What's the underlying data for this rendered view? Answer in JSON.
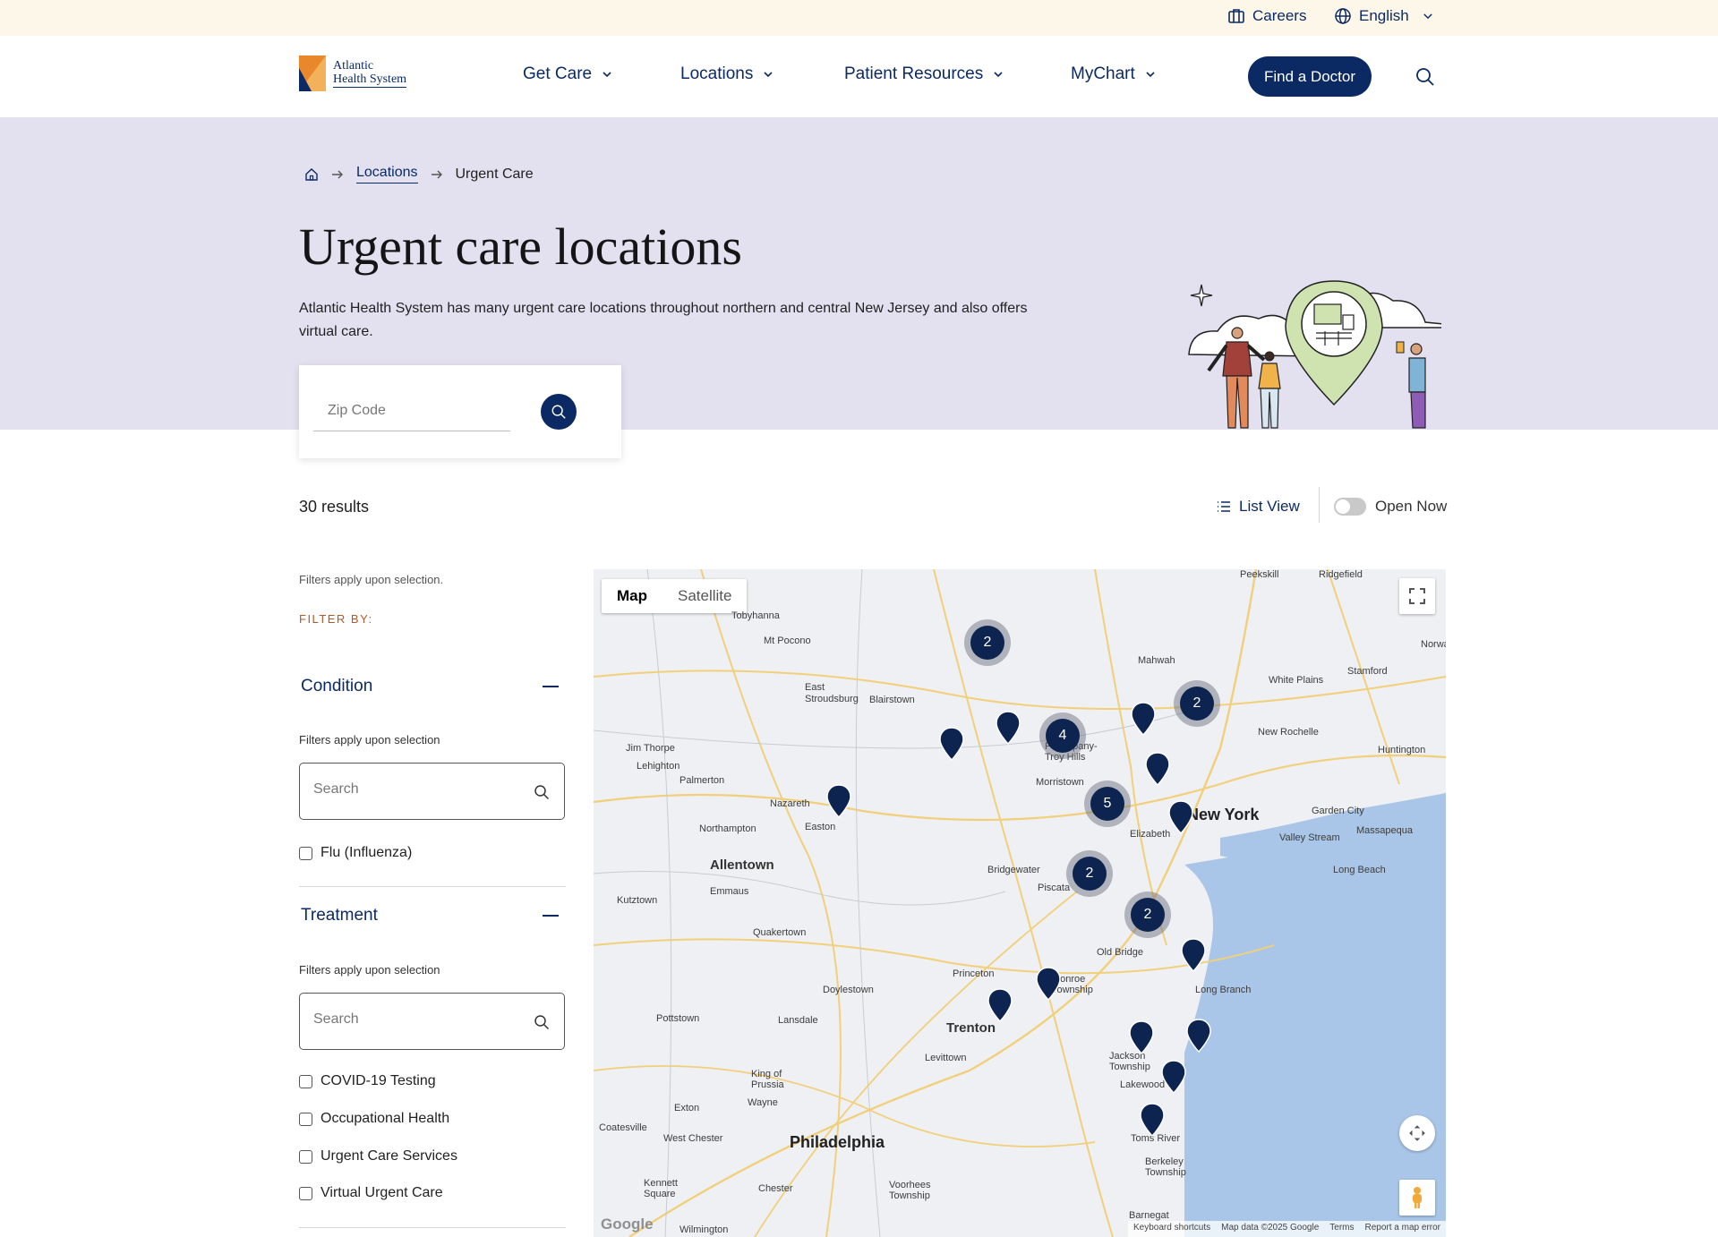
{
  "utility": {
    "careers": "Careers",
    "language": "English"
  },
  "brand": {
    "line1": "Atlantic",
    "line2": "Health System",
    "navy": "#0b2a63",
    "orange": "#e8872b"
  },
  "nav": [
    {
      "label": "Get Care"
    },
    {
      "label": "Locations"
    },
    {
      "label": "Patient Resources"
    },
    {
      "label": "MyChart"
    }
  ],
  "cta": {
    "find_doctor": "Find a Doctor"
  },
  "breadcrumb": {
    "link": "Locations",
    "current": "Urgent Care"
  },
  "hero": {
    "title": "Urgent care locations",
    "description": "Atlantic Health System has many urgent care locations throughout northern and central New Jersey and also offers virtual care.",
    "background": "#e3e0ef"
  },
  "zip": {
    "placeholder": "Zip Code"
  },
  "results": {
    "count": "30 results",
    "list_view": "List View",
    "open_now": "Open Now"
  },
  "filters": {
    "note": "Filters apply upon selection.",
    "filter_by": "FILTER BY:",
    "condition": {
      "title": "Condition",
      "note": "Filters apply upon selection",
      "search_placeholder": "Search",
      "options": [
        "Flu (Influenza)"
      ]
    },
    "treatment": {
      "title": "Treatment",
      "note": "Filters apply upon selection",
      "search_placeholder": "Search",
      "options": [
        "COVID-19 Testing",
        "Occupational Health",
        "Urgent Care Services",
        "Virtual Urgent Care"
      ]
    }
  },
  "map": {
    "tabs": {
      "map": "Map",
      "satellite": "Satellite"
    },
    "places": {
      "new_york": "New York",
      "philadelphia": "Philadelphia",
      "trenton": "Trenton",
      "allentown": "Allentown",
      "morristown": "Morristown",
      "elizabeth": "Elizabeth",
      "bridgewater": "Bridgewater",
      "princeton": "Princeton",
      "toms_river": "Toms River",
      "long_branch": "Long Branch",
      "lakewood": "Lakewood",
      "easton": "Easton",
      "nazareth": "Nazareth",
      "white_plains": "White Plains",
      "new_rochelle": "New Rochelle",
      "stamford": "Stamford",
      "huntington": "Huntington",
      "garden_city": "Garden City",
      "valley_stream": "Valley Stream",
      "long_beach": "Long Beach",
      "massapequa": "Massapequa",
      "doylestown": "Doylestown",
      "levittown": "Levittown",
      "lansdale": "Lansdale",
      "pottstown": "Pottstown",
      "kutztown": "Kutztown",
      "emmaus": "Emmaus",
      "quakertown": "Quakertown",
      "northampton": "Northampton",
      "palmerton": "Palmerton",
      "lehighton": "Lehighton",
      "jim_thorpe": "Jim Thorpe",
      "east_stroudsburg": "East Stroudsburg",
      "blairstown": "Blairstown",
      "mt_pocono": "Mt Pocono",
      "tobyhanna": "Tobyhanna",
      "mahwah": "Mahwah",
      "norwalk": "Norwalk",
      "ridgefield": "Ridgefield",
      "peekskill": "Peekskill",
      "king_of_prussia": "King of Prussia",
      "wayne": "Wayne",
      "exton": "Exton",
      "west_chester": "West Chester",
      "coatesville": "Coatesville",
      "chester": "Chester",
      "kennett_square": "Kennett Square",
      "voorhees": "Voorhees Township",
      "wilmington": "Wilmington",
      "barnegat": "Barnegat",
      "berkeley": "Berkeley Township",
      "jackson": "Jackson Township",
      "old_bridge": "Old Bridge",
      "piscataway": "Piscata",
      "monroe": "Monroe Township",
      "parsippany": "Parsippany-Troy Hills"
    },
    "clusters": [
      "2",
      "2",
      "4",
      "5",
      "2",
      "2"
    ],
    "attribution": {
      "keyboard": "Keyboard shortcuts",
      "data": "Map data ©2025 Google",
      "terms": "Terms",
      "report": "Report a map error"
    },
    "google": "Google"
  }
}
